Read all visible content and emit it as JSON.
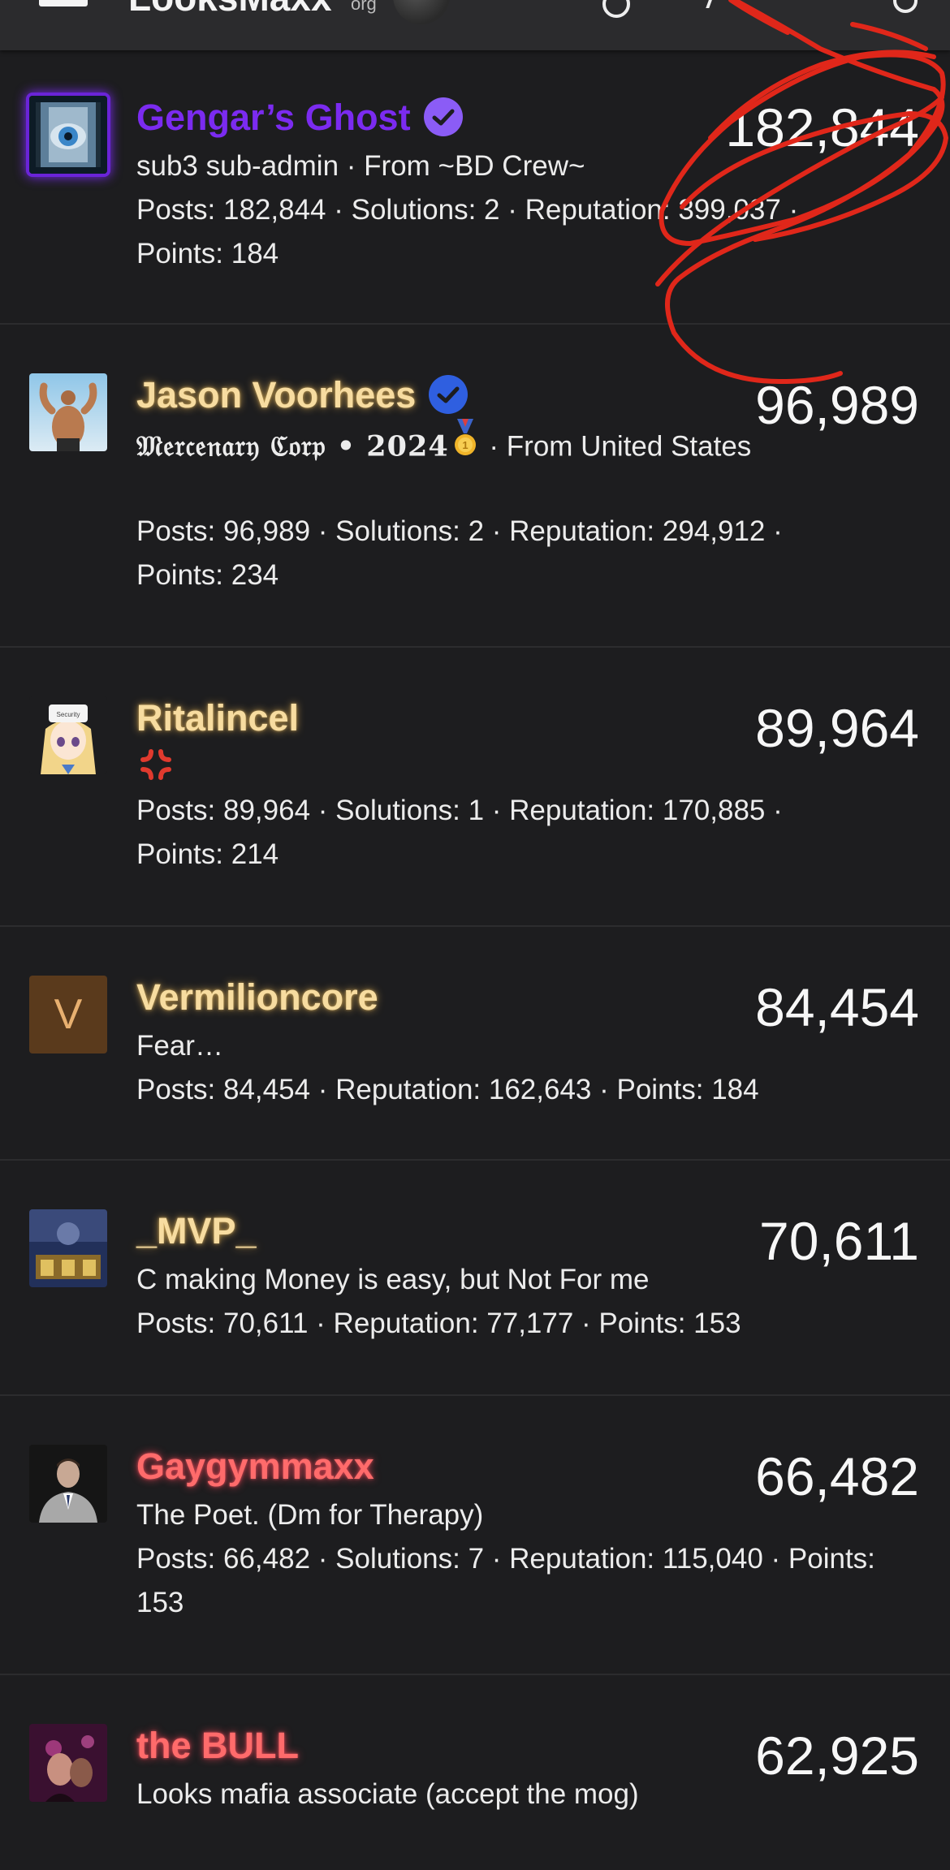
{
  "header": {
    "site_name": "LooksMaxx",
    "site_tld": "org"
  },
  "members": [
    {
      "name": "Gengar’s Ghost",
      "verified": true,
      "badge_color": "#8b5cf6",
      "count": "182,844",
      "subtitle": "sub3 sub-admin · From ~BD Crew~",
      "stats": "Posts: 182,844 · Solutions: 2 · Reputation: 399,037 · Points: 184",
      "name_color": "#7b2bf0"
    },
    {
      "name": "Jason Voorhees",
      "verified": true,
      "badge_color": "#2f5fe0",
      "count": "96,989",
      "subtitle_title": "𝔐𝔢𝔯𝔠𝔢𝔫𝔞𝔯𝔶 ℭ𝔬𝔯𝔭 • 2024",
      "subtitle_rest": " · From United States",
      "stats": "Posts: 96,989 · Solutions: 2 · Reputation: 294,912 · Points: 234"
    },
    {
      "name": "Ritalincel",
      "count": "89,964",
      "subtitle_emoji": "anger-symbol",
      "stats": "Posts: 89,964 · Solutions: 1 · Reputation: 170,885 · Points: 214"
    },
    {
      "name": "Vermilioncore",
      "avatar_letter": "V",
      "avatar_bg": "#5a3a1c",
      "avatar_fg": "#e8b070",
      "count": "84,454",
      "subtitle": "Fear…",
      "stats": "Posts: 84,454 · Reputation: 162,643 · Points: 184"
    },
    {
      "name": "_MVP_",
      "count": "70,611",
      "subtitle": "C making Money is easy, but Not For me",
      "stats": "Posts: 70,611 · Reputation: 77,177 · Points: 153"
    },
    {
      "name": "Gaygymmaxx",
      "count": "66,482",
      "subtitle": "The Poet. (Dm for Therapy)",
      "stats": "Posts: 66,482 · Solutions: 7 · Reputation: 115,040 · Points: 153"
    },
    {
      "name": "the BULL",
      "count": "62,925",
      "subtitle": "Looks mafia associate (accept the mog)"
    }
  ],
  "colors": {
    "background": "#1d1d1f",
    "divider": "#2c2c2e",
    "scribble": "#e0271a"
  }
}
